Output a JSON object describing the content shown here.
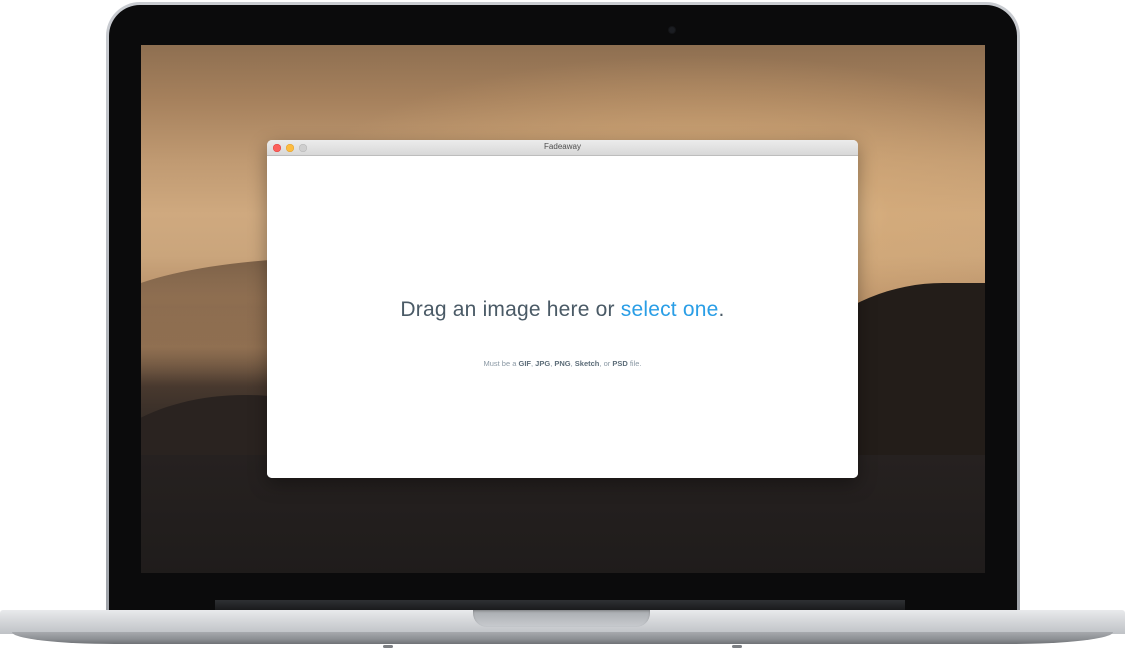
{
  "window": {
    "title": "Fadeaway"
  },
  "dropzone": {
    "headline_prefix": "Drag an image here or ",
    "headline_link": "select one",
    "headline_suffix": ".",
    "formats_prefix": "Must be a ",
    "formats": [
      "GIF",
      "JPG",
      "PNG",
      "Sketch",
      "PSD"
    ],
    "formats_suffix": " file."
  },
  "colors": {
    "link": "#2a9ee6",
    "headline": "#4a5a66",
    "close": "#fc605c",
    "minimize": "#fdbc40",
    "zoom_inactive": "#cfcfcf"
  },
  "icons": {
    "close": "close-traffic-light",
    "minimize": "minimize-traffic-light",
    "zoom": "zoom-traffic-light"
  }
}
